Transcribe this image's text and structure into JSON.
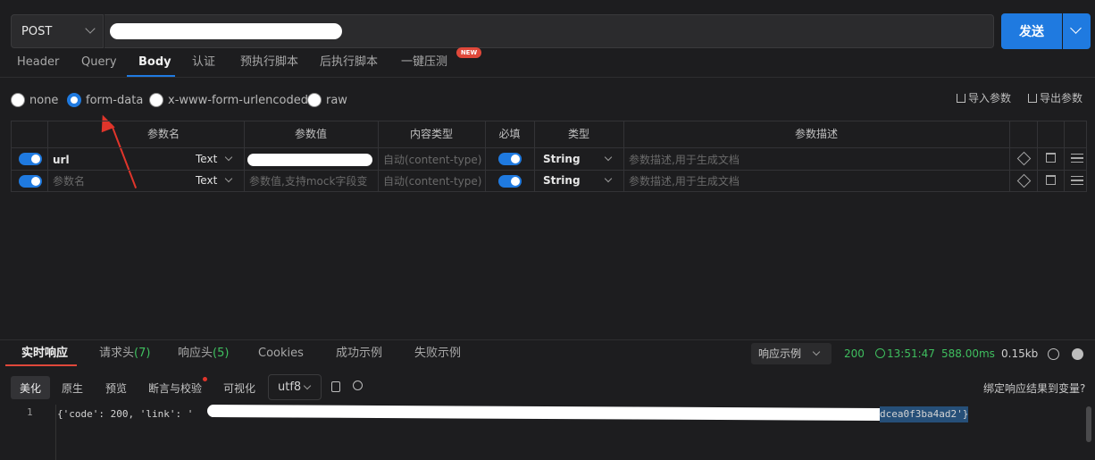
{
  "request": {
    "method": "POST",
    "send_label": "发送"
  },
  "tabs": [
    "Header",
    "Query",
    "Body",
    "认证",
    "预执行脚本",
    "后执行脚本",
    "一键压测"
  ],
  "new_badge": "NEW",
  "body_types": [
    "none",
    "form-data",
    "x-www-form-urlencoded",
    "raw"
  ],
  "body_selected": "form-data",
  "actions": {
    "import": "导入参数",
    "export": "导出参数"
  },
  "table": {
    "headers": [
      "参数名",
      "参数值",
      "内容类型",
      "必填",
      "类型",
      "参数描述"
    ],
    "rows": [
      {
        "name": "url",
        "name_is_placeholder": false,
        "field_type": "Text",
        "value": "",
        "value_placeholder": "",
        "content_type": "自动(content-type)",
        "required": true,
        "type": "String",
        "desc": "参数描述,用于生成文档"
      },
      {
        "name": "参数名",
        "name_is_placeholder": true,
        "field_type": "Text",
        "value": "",
        "value_placeholder": "参数值,支持mock字段变",
        "content_type": "自动(content-type)",
        "required": true,
        "type": "String",
        "desc": "参数描述,用于生成文档"
      }
    ]
  },
  "response": {
    "tabs": [
      "实时响应",
      "请求头",
      "响应头",
      "Cookies",
      "成功示例",
      "失败示例"
    ],
    "request_headers_count": "(7)",
    "response_headers_count": "(5)",
    "example_select": "响应示例",
    "status": "200",
    "time": "13:51:47",
    "duration": "588.00ms",
    "size": "0.15kb",
    "toolbar": [
      "美化",
      "原生",
      "预览",
      "断言与校验",
      "可视化"
    ],
    "encoding": "utf8",
    "bind_label": "绑定响应结果到变量?",
    "line_number": "1",
    "code_start": "{'code': 200, 'link': '",
    "code_end": "dcea0f3ba4ad2'}"
  },
  "colors": {
    "accent": "#1f7ae0",
    "success": "#3fbf5f",
    "danger": "#e0483a"
  }
}
